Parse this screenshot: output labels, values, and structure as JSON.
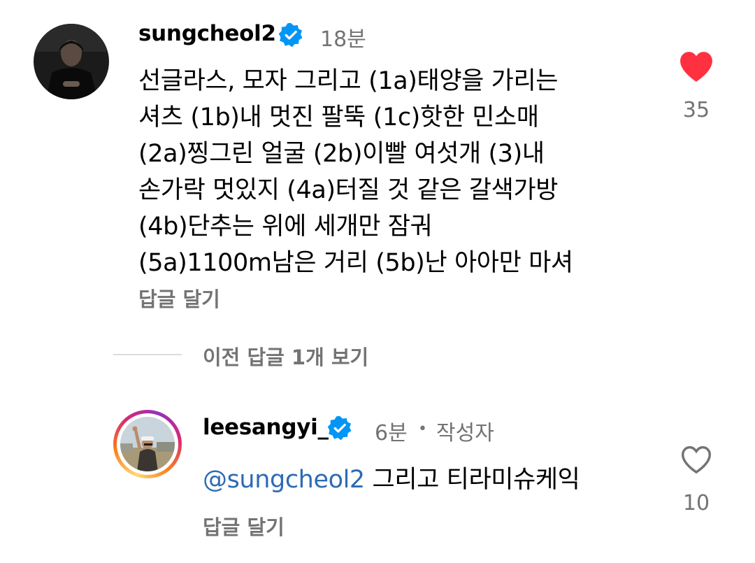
{
  "comments": [
    {
      "username": "sungcheol2",
      "time": "18분",
      "text_lines": [
        "선글라스, 모자 그리고 (1a)태양을 가리는",
        "셔츠 (1b)내 멋진 팔뚝 (1c)핫한 민소매",
        "(2a)찡그린 얼굴 (2b)이빨 여섯개 (3)내",
        "손가락 멋있지 (4a)터질 것 같은 갈색가방",
        "(4b)단추는 위에 세개만 잠궈",
        "(5a)1100m남은 거리 (5b)난 아아만 마셔"
      ],
      "reply_label": "답글 달기",
      "likes": "35",
      "liked": true,
      "verified": true
    }
  ],
  "view_replies_label": "이전 답글 1개 보기",
  "reply": {
    "username": "leesangyi_",
    "time": "6분",
    "author_badge": "작성자",
    "mention": "@sungcheol2",
    "text": "그리고 티라미슈케익",
    "reply_label": "답글 달기",
    "likes": "10",
    "liked": false,
    "verified": true
  },
  "colors": {
    "heart_filled": "#ff3040",
    "verified_blue": "#0095f6",
    "mention_blue": "#2d6bb6",
    "secondary_text": "#737373"
  },
  "icons": {
    "verified": "verified-badge-icon",
    "like_filled": "heart-filled-icon",
    "like_outline": "heart-outline-icon"
  }
}
